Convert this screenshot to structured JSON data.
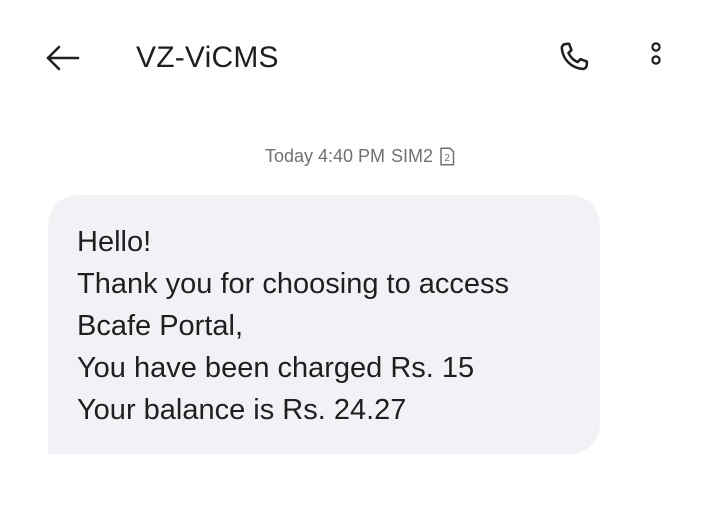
{
  "header": {
    "title": "VZ-ViCMS",
    "icons": {
      "back": "arrow-left-icon",
      "call": "phone-icon",
      "menu": "more-vertical-icon"
    }
  },
  "thread": {
    "timestamp": "Today 4:40 PM",
    "sim_label": "SIM2",
    "sim_icon": "sim-card-2-icon",
    "message": {
      "lines": [
        "Hello!",
        "Thank you for choosing to access",
        "Bcafe Portal,",
        "You have been charged Rs. 15",
        "Your balance is Rs. 24.27"
      ],
      "bubble_color": "#f2f2f6"
    }
  }
}
